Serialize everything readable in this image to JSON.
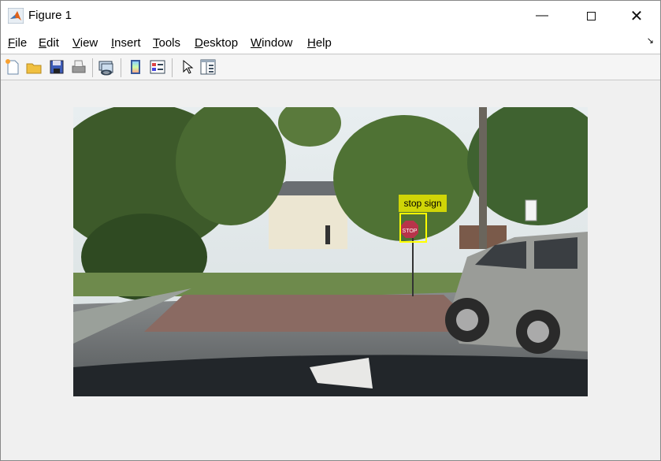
{
  "window": {
    "title": "Figure 1",
    "minimize_icon": "minimize-icon",
    "maximize_icon": "maximize-icon",
    "close_icon": "close-icon"
  },
  "menu": {
    "items": [
      {
        "accel": "F",
        "rest": "ile"
      },
      {
        "accel": "E",
        "rest": "dit"
      },
      {
        "accel": "V",
        "rest": "iew"
      },
      {
        "accel": "I",
        "rest": "nsert"
      },
      {
        "accel": "T",
        "rest": "ools"
      },
      {
        "accel": "D",
        "rest": "esktop"
      },
      {
        "accel": "W",
        "rest": "indow"
      },
      {
        "accel": "H",
        "rest": "elp"
      }
    ]
  },
  "toolbar": {
    "icons": [
      "new-figure-icon",
      "open-icon",
      "save-icon",
      "print-icon",
      "link-plot-icon",
      "colorbar-icon",
      "legend-icon",
      "pointer-icon",
      "property-inspector-icon"
    ]
  },
  "image": {
    "sign_text": "STOP",
    "annotation": {
      "label": "stop sign",
      "color": "#ffff00"
    }
  }
}
